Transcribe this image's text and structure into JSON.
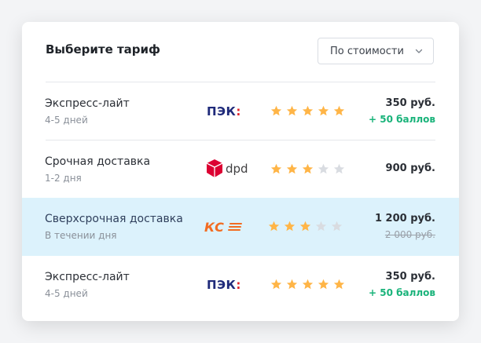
{
  "header": {
    "title": "Выберите тариф",
    "sort_label": "По стоимости"
  },
  "tariffs": [
    {
      "name": "Экспресс-лайт",
      "duration": "4-5 дней",
      "carrier": "ПЭК:",
      "rating": 5,
      "price": "350 руб.",
      "bonus": "+ 50 баллов"
    },
    {
      "name": "Срочная доставка",
      "duration": "1-2 дня",
      "carrier": "dpd",
      "rating": 3,
      "price": "900 руб."
    },
    {
      "name": "Сверхсрочная доставка",
      "duration": "В течении дня",
      "carrier": "КС",
      "rating": 3,
      "price": "1 200 руб.",
      "old_price": "2 000 руб.",
      "selected": true
    },
    {
      "name": "Экспресс-лайт",
      "duration": "4-5 дней",
      "carrier": "ПЭК:",
      "rating": 5,
      "price": "350 руб.",
      "bonus": "+ 50 баллов"
    }
  ],
  "colors": {
    "star_active": "#ffb547",
    "star_inactive": "#d9dce1",
    "bonus": "#19b37a",
    "highlight": "#dcf2fc",
    "pek_blue": "#1f2a7a",
    "pek_red": "#e0242b",
    "dpd_red": "#dc0032",
    "kse_orange": "#f26c22"
  },
  "icons": {
    "sort": "chevron-down-icon",
    "star": "star-icon",
    "dpd_cube": "dpd-cube-icon"
  }
}
